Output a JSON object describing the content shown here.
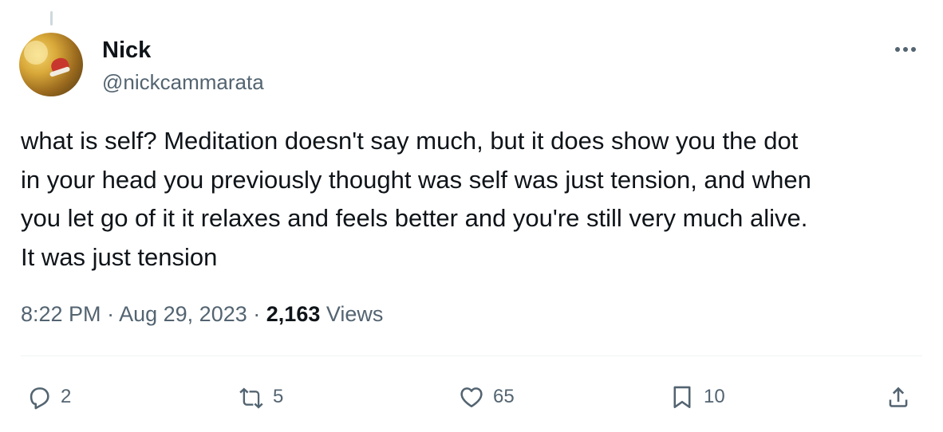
{
  "author": {
    "name": "Nick",
    "handle": "@nickcammarata"
  },
  "tweet": {
    "lines": [
      "what is self? Meditation doesn't say much, but it does show you the dot",
      "in your head you previously thought was self was just tension, and when",
      "you let go of it it relaxes and feels better and you're still very much alive.",
      "It was just tension"
    ]
  },
  "meta": {
    "time": "8:22 PM",
    "separator": "·",
    "date": "Aug 29, 2023",
    "views_count": "2,163",
    "views_label": "Views"
  },
  "actions": {
    "replies": {
      "icon": "reply-icon",
      "count": "2"
    },
    "retweets": {
      "icon": "retweet-icon",
      "count": "5"
    },
    "likes": {
      "icon": "heart-icon",
      "count": "65"
    },
    "bookmarks": {
      "icon": "bookmark-icon",
      "count": "10"
    },
    "share": {
      "icon": "share-icon"
    }
  },
  "colors": {
    "text_primary": "#0f1419",
    "text_secondary": "#536471",
    "divider": "#eff3f4"
  }
}
